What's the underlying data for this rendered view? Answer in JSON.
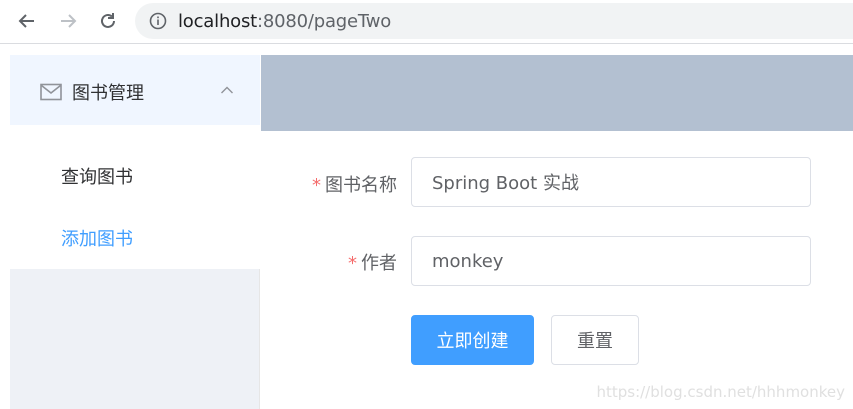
{
  "browser": {
    "url_host": "localhost",
    "url_rest": ":8080/pageTwo"
  },
  "sidebar": {
    "submenu_title": "图书管理",
    "items": [
      {
        "label": "查询图书"
      },
      {
        "label": "添加图书"
      }
    ]
  },
  "form": {
    "fields": [
      {
        "label": "图书名称",
        "required_mark": "*",
        "value": "Spring Boot 实战"
      },
      {
        "label": "作者",
        "required_mark": "*",
        "value": "monkey"
      }
    ],
    "submit_label": "立即创建",
    "reset_label": "重置"
  },
  "watermark": "https://blog.csdn.net/hhhmonkey",
  "colors": {
    "primary": "#409eff",
    "header_bg": "#b3c0d1",
    "sidebar_bg": "#eef1f6",
    "required": "#f56c6c"
  }
}
